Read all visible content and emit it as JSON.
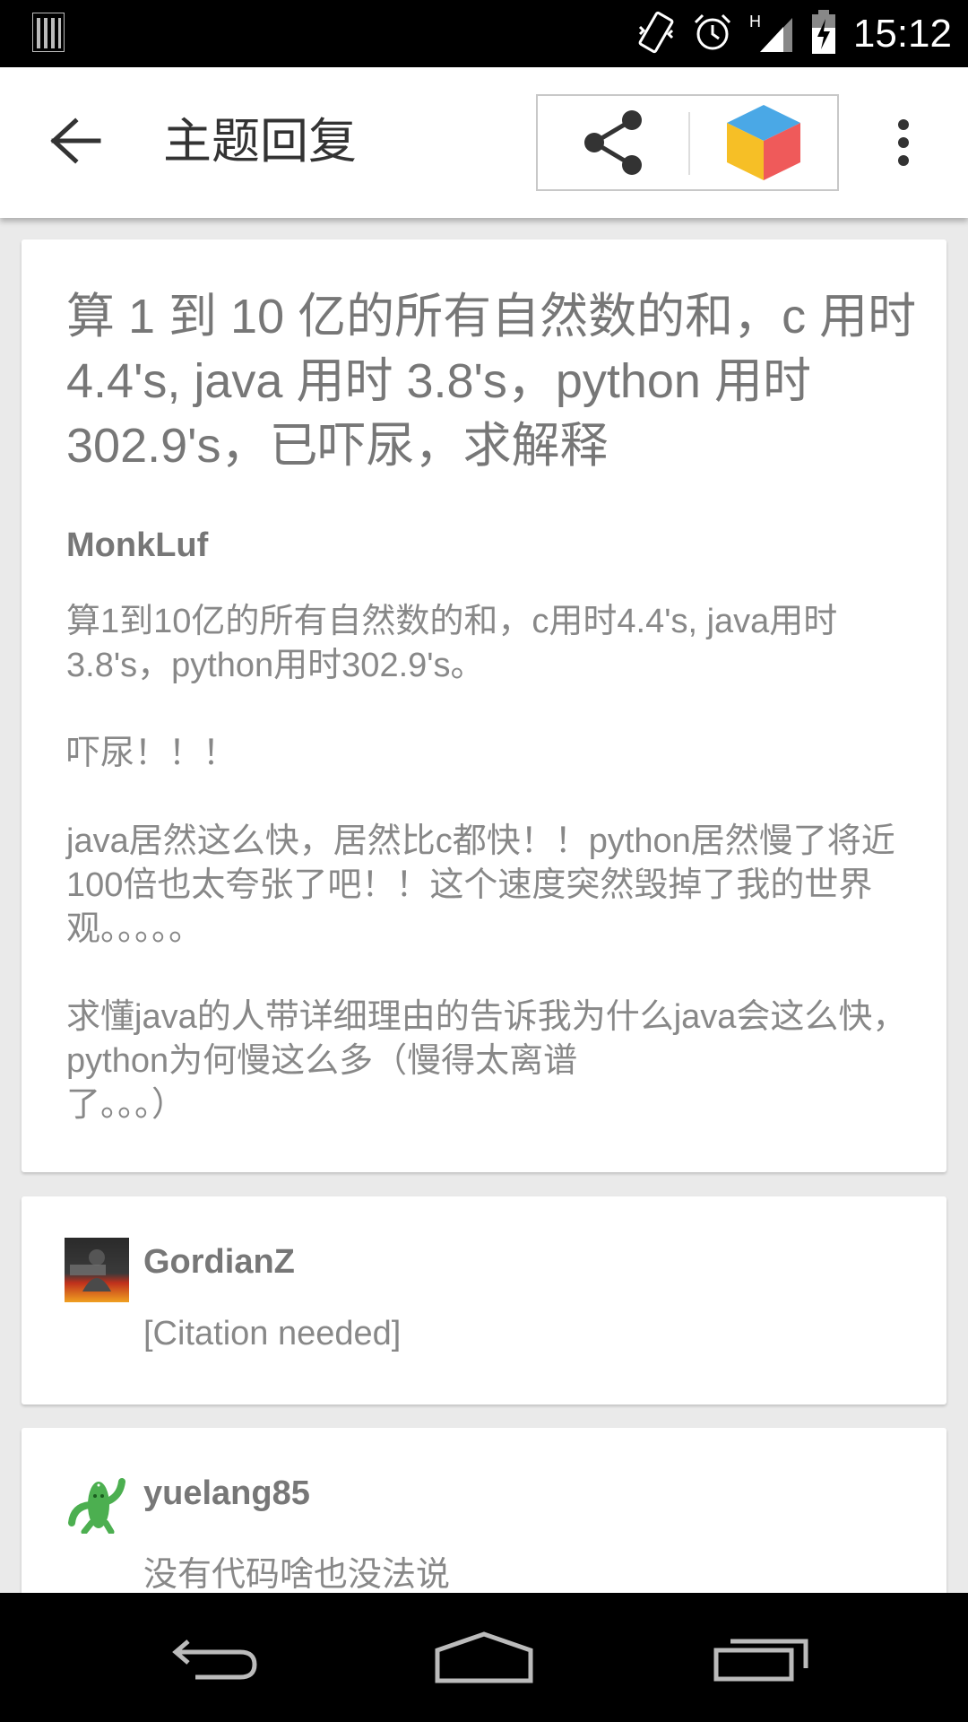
{
  "status_bar": {
    "time": "15:12",
    "icons": [
      "notification-icon",
      "vibrate-icon",
      "alarm-icon",
      "signal-icon",
      "battery-charging-icon"
    ],
    "network_type": "H"
  },
  "app_bar": {
    "title": "主题回复",
    "icons": [
      "back-arrow-icon",
      "share-icon",
      "cube-icon",
      "overflow-menu-icon"
    ]
  },
  "post": {
    "title": "算 1 到 10 亿的所有自然数的和，c 用时 4.4's, java 用时 3.8's，python 用时 302.9's，已吓尿，求解释",
    "author": "MonkLuf",
    "paragraphs": [
      "算1到10亿的所有自然数的和，c用时4.4's, java用时3.8's，python用时302.9's。",
      "吓尿！！！",
      "java居然这么快，居然比c都快！！python居然慢了将近100倍也太夸张了吧！！这个速度突然毁掉了我的世界观。。。。。",
      "求懂java的人带详细理由的告诉我为什么java会这么快，python为何慢这么多（慢得太离谱\n了。。。）"
    ]
  },
  "replies": [
    {
      "author": "GordianZ",
      "text": "[Citation needed]",
      "avatar_icon": "cars-game-avatar"
    },
    {
      "author": "yuelang85",
      "text": "没有代码啥也没法说",
      "avatar_icon": "cactus-avatar"
    }
  ],
  "nav_bar": {
    "icons": [
      "back-nav-icon",
      "home-nav-icon",
      "recents-nav-icon"
    ]
  },
  "colors": {
    "cube_top": "#4aa8e6",
    "cube_left": "#f6bf26",
    "cube_right": "#ef5a5a"
  }
}
